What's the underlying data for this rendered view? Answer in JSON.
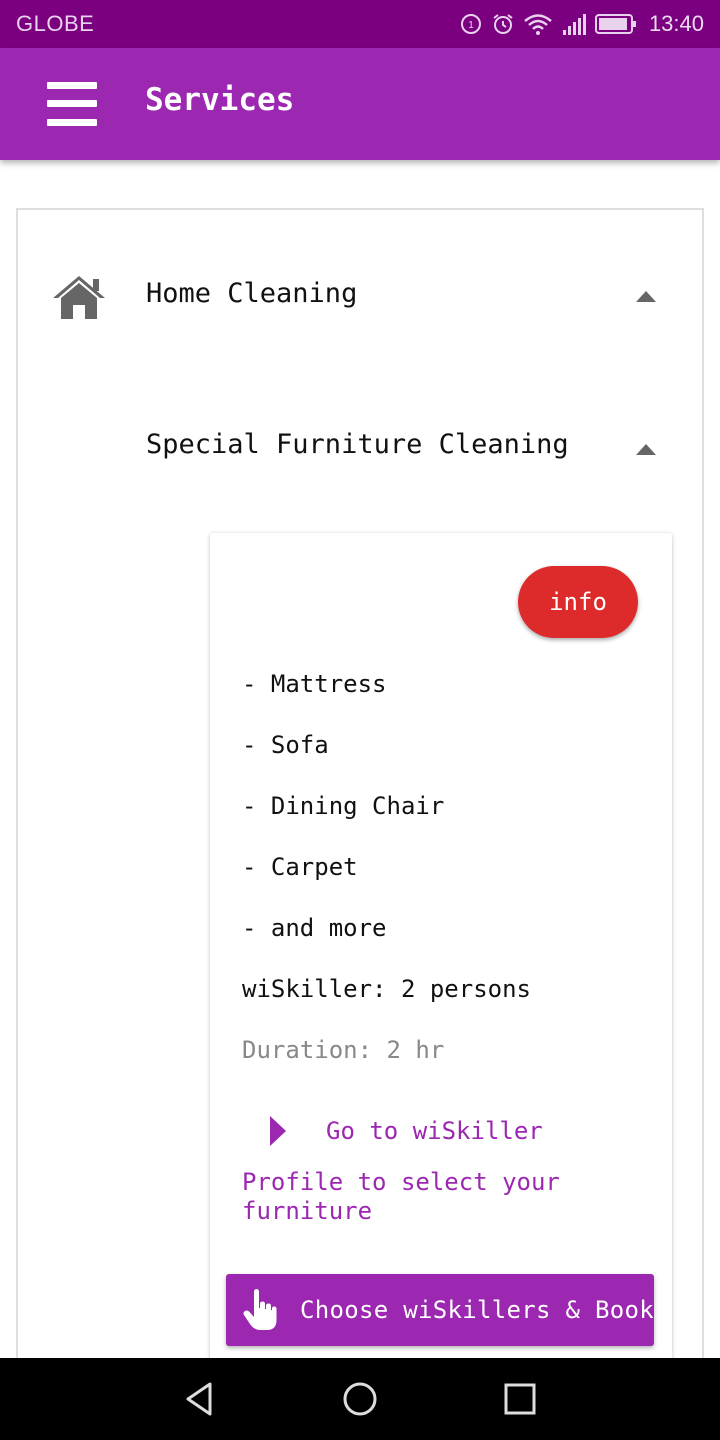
{
  "status_bar": {
    "carrier": "GLOBE",
    "time": "13:40",
    "icons": [
      "data-saver-icon",
      "alarm-icon",
      "wifi-icon",
      "signal-icon",
      "battery-icon"
    ]
  },
  "app_bar": {
    "title": "Services",
    "menu_icon": "hamburger-menu-icon"
  },
  "category": {
    "icon": "house-icon",
    "title": "Home Cleaning",
    "expanded": true
  },
  "subcategory": {
    "title": "Special Furniture Cleaning",
    "expanded": true
  },
  "service_card": {
    "info_label": "info",
    "items": [
      "- Mattress",
      "- Sofa",
      "- Dining Chair",
      "- Carpet",
      "- and more"
    ],
    "wiskiller_text": "wiSkiller: 2 persons",
    "duration_text": "Duration: 2 hr",
    "goto_text": "Go to wiSkiller",
    "profile_text": "Profile to select your furniture",
    "book_label": "Choose wiSkillers & Book",
    "book_icon": "hand-pointer-icon"
  },
  "colors": {
    "status_bar": "#7b0080",
    "app_bar": "#9c27b0",
    "accent": "#9c27b0",
    "info_button": "#dd2a2a"
  },
  "nav_bar": {
    "icons": [
      "back-icon",
      "home-icon",
      "recents-icon"
    ]
  }
}
